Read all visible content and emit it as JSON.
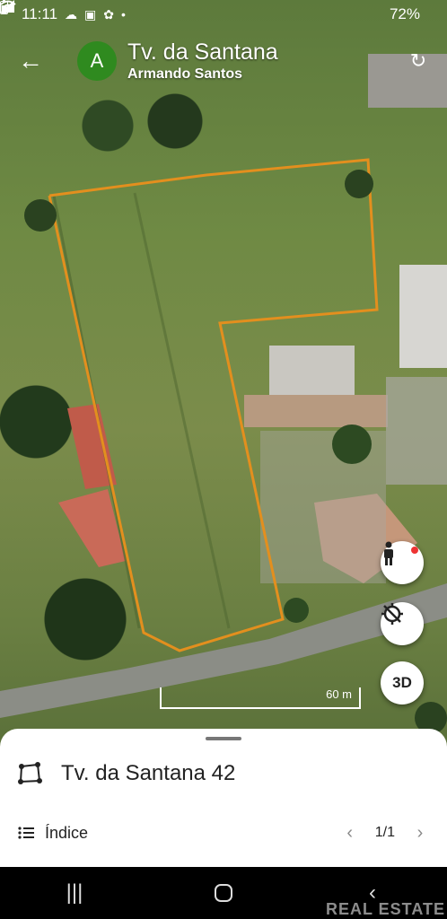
{
  "status_bar": {
    "time": "11:11",
    "battery": "72%",
    "left_icons": [
      "cloud-icon",
      "image-icon",
      "notification-icon",
      "dot-icon"
    ],
    "right_icons": [
      "wifi-icon",
      "signal-icon",
      "battery-icon"
    ]
  },
  "header": {
    "avatar_letter": "A",
    "title": "Tv. da Santana",
    "subtitle": "Armando Santos",
    "avatar_color": "#2f8a1f"
  },
  "map": {
    "scale_label": "60 m",
    "parcel_outline_color": "#e38f1e",
    "controls": {
      "pegman": "pegman-icon",
      "compass": "compass-icon",
      "three_d_label": "3D"
    }
  },
  "bottom_sheet": {
    "title": "Tv. da Santana 42",
    "index_label": "Índice",
    "page_indicator": "1/1"
  },
  "watermark": "REAL ESTATE"
}
